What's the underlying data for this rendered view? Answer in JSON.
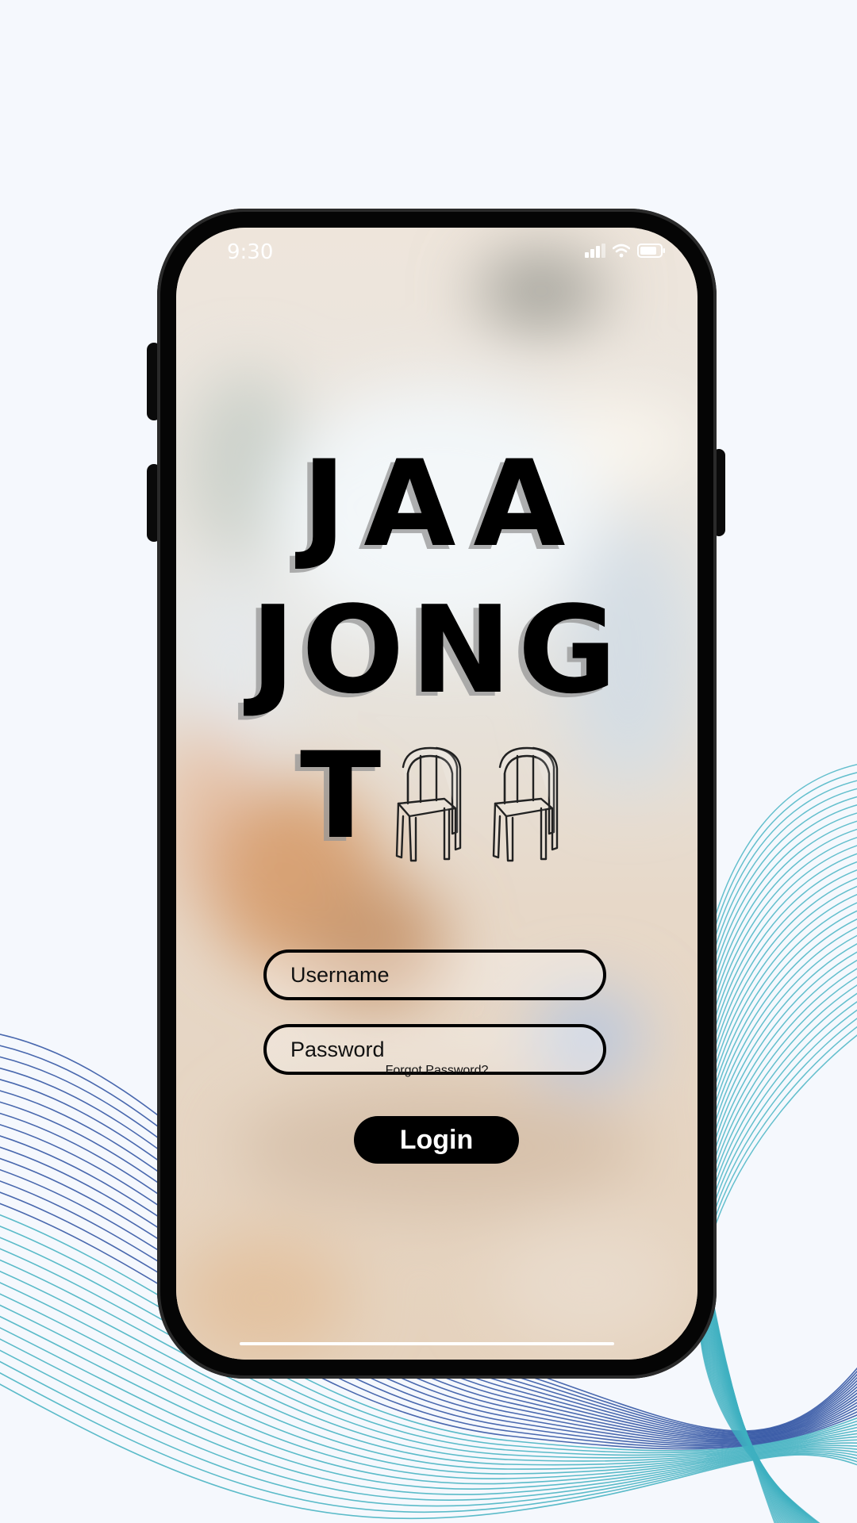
{
  "status_bar": {
    "time": "9:30",
    "signal_icon": "cellular-signal-icon",
    "wifi_icon": "wifi-icon",
    "battery_icon": "battery-icon"
  },
  "logo": {
    "line1": "JAA",
    "line2": "JONG",
    "line3_letter": "T",
    "chair_icon": "chair-icon"
  },
  "form": {
    "username_placeholder": "Username",
    "password_placeholder": "Password",
    "forgot_label": "Forgot Password?",
    "login_label": "Login"
  },
  "colors": {
    "page_bg": "#f5f8fd",
    "wave_blue": "#2a4fa0",
    "wave_teal": "#3fb0c0",
    "phone_frame": "#050505",
    "button": "#000000"
  }
}
